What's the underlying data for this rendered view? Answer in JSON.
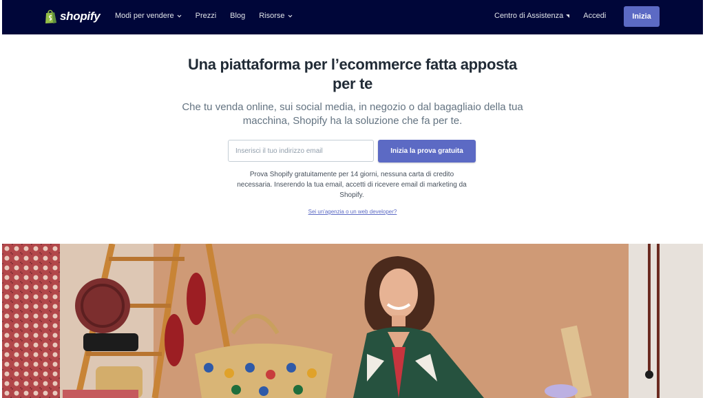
{
  "nav": {
    "logo_text": "shopify",
    "items": [
      {
        "label": "Modi per vendere",
        "dropdown": true
      },
      {
        "label": "Prezzi",
        "dropdown": false
      },
      {
        "label": "Blog",
        "dropdown": false
      },
      {
        "label": "Risorse",
        "dropdown": true
      }
    ],
    "help_label": "Centro di Assistenza",
    "login_label": "Accedi",
    "signup_label": "Inizia"
  },
  "hero": {
    "title": "Una piattaforma per l’ecommerce fatta apposta per te",
    "subtitle": "Che tu venda online, sui social media, in negozio o dal bagagliaio della tua macchina, Shopify ha la soluzione che fa per te.",
    "email_placeholder": "Inserisci il tuo indirizzo email",
    "email_value": "",
    "cta_label": "Inizia la prova gratuita",
    "disclaimer": "Prova Shopify gratuitamente per 14 giorni, nessuna carta di credito necessaria. Inserendo la tua email, accetti di ricevere email di marketing da Shopify.",
    "agency_link": "Sei un'agenzia o un web developer?"
  },
  "colors": {
    "nav_bg": "#000639",
    "accent": "#5c6ac4",
    "heading": "#212b36",
    "body_text": "#637381"
  }
}
